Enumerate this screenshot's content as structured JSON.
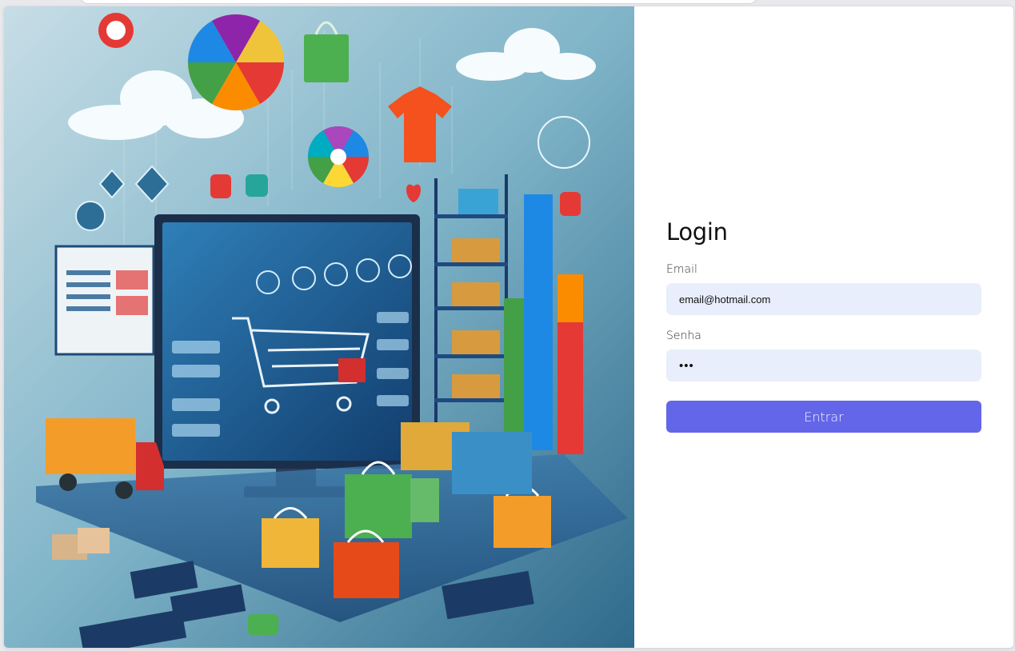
{
  "login": {
    "title": "Login",
    "email_label": "Email",
    "email_value": "email@hotmail.com",
    "password_label": "Senha",
    "password_value": "123",
    "submit_label": "Entrar"
  },
  "colors": {
    "accent": "#6366e8",
    "input_bg": "#e8eefb",
    "panel_bg": "#ffffff"
  },
  "illustration": {
    "subject": "e-commerce illustration: computer screen with shopping cart, shopping bags, boxes, delivery truck, bar chart, clouds and icons"
  }
}
